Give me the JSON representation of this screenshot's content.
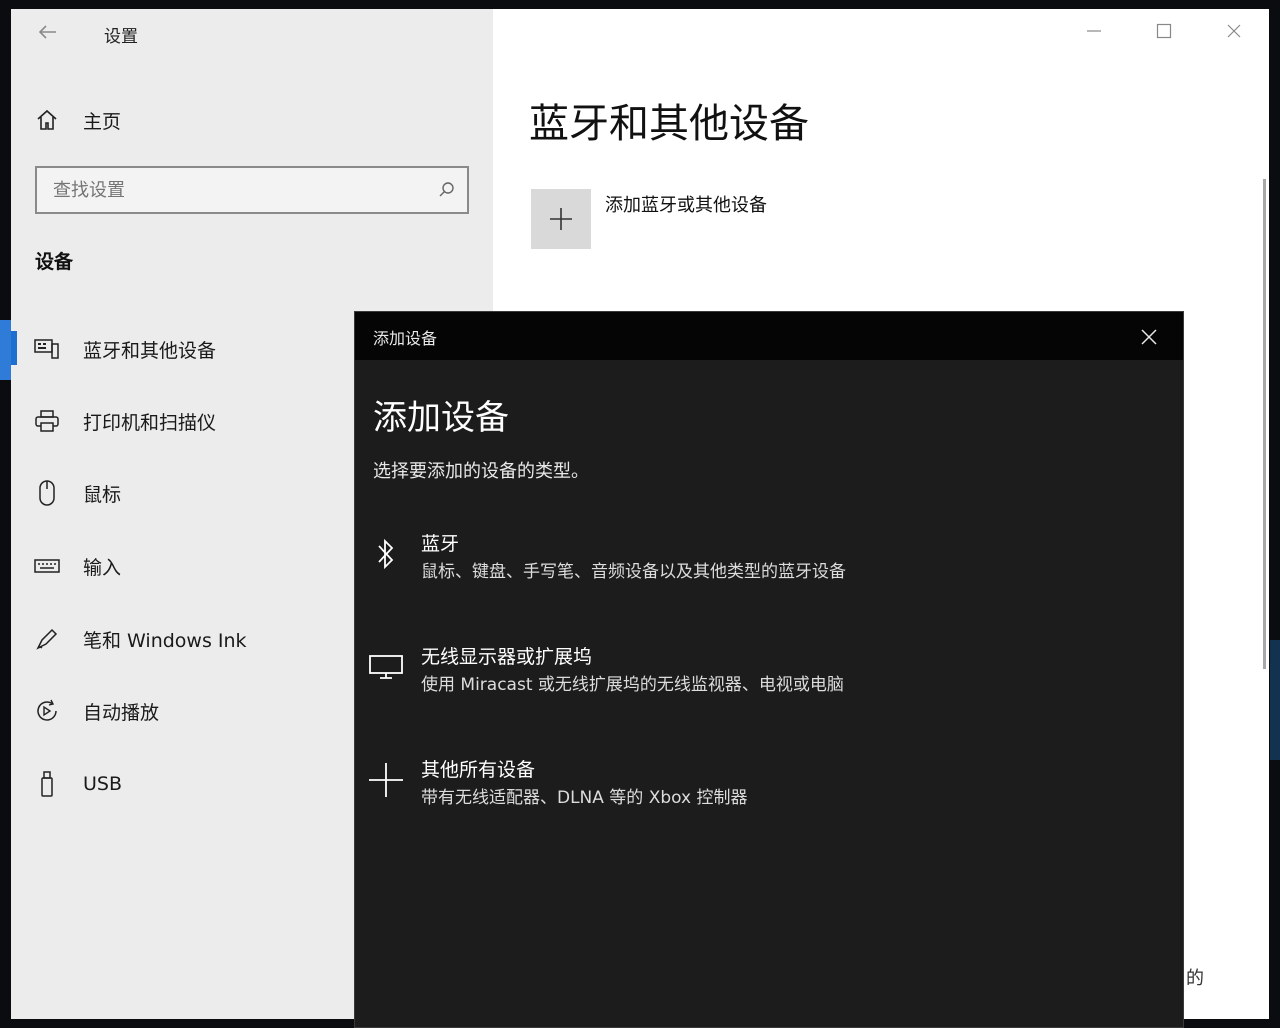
{
  "window": {
    "title": "设置",
    "controls": {
      "minimize": "—",
      "maximize": "☐",
      "close": "✕"
    }
  },
  "sidebar": {
    "home_label": "主页",
    "search_placeholder": "查找设置",
    "section_title": "设备",
    "items": [
      {
        "label": "蓝牙和其他设备",
        "icon": "bluetooth-devices-icon"
      },
      {
        "label": "打印机和扫描仪",
        "icon": "printer-icon"
      },
      {
        "label": "鼠标",
        "icon": "mouse-icon"
      },
      {
        "label": "输入",
        "icon": "keyboard-icon"
      },
      {
        "label": "笔和 Windows Ink",
        "icon": "pen-icon"
      },
      {
        "label": "自动播放",
        "icon": "autoplay-icon"
      },
      {
        "label": "USB",
        "icon": "usb-icon"
      }
    ]
  },
  "main": {
    "heading": "蓝牙和其他设备",
    "add_device_label": "添加蓝牙或其他设备",
    "partial_text": "的"
  },
  "dialog": {
    "title": "添加设备",
    "heading": "添加设备",
    "subtitle": "选择要添加的设备的类型。",
    "options": [
      {
        "title": "蓝牙",
        "description": "鼠标、键盘、手写笔、音频设备以及其他类型的蓝牙设备",
        "icon": "bluetooth-icon"
      },
      {
        "title": "无线显示器或扩展坞",
        "description": "使用 Miracast 或无线扩展坞的无线监视器、电视或电脑",
        "icon": "monitor-icon"
      },
      {
        "title": "其他所有设备",
        "description": "带有无线适配器、DLNA 等的 Xbox 控制器",
        "icon": "plus-icon"
      }
    ]
  },
  "colors": {
    "accent": "#1f6fd1",
    "sidebar_bg": "#ececec",
    "dialog_bg": "#1c1c1c",
    "dialog_titlebar": "#050505"
  }
}
